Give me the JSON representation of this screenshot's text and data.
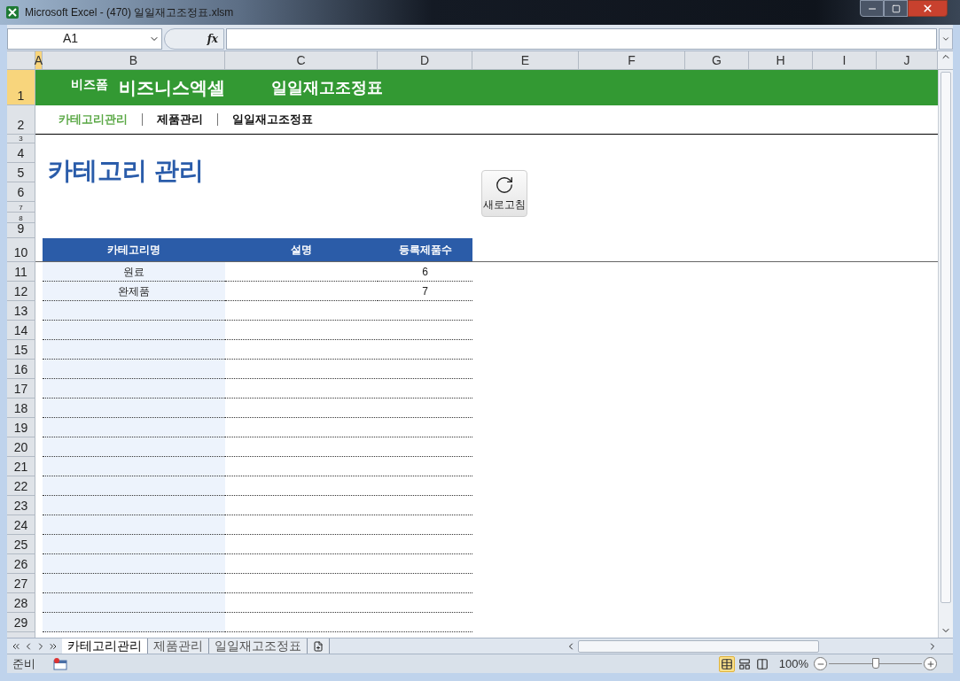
{
  "window": {
    "title": "Microsoft Excel - (470) 일일재고조정표.xlsm"
  },
  "formula_bar": {
    "name_box": "A1",
    "function_label": "fx"
  },
  "columns": [
    {
      "label": "A",
      "selected": true
    },
    {
      "label": "B",
      "selected": false
    },
    {
      "label": "C",
      "selected": false
    },
    {
      "label": "D",
      "selected": false
    },
    {
      "label": "E",
      "selected": false
    },
    {
      "label": "F",
      "selected": false
    },
    {
      "label": "G",
      "selected": false
    },
    {
      "label": "H",
      "selected": false
    },
    {
      "label": "I",
      "selected": false
    },
    {
      "label": "J",
      "selected": false
    }
  ],
  "rows": [
    {
      "label": "1",
      "selected": true
    },
    {
      "label": "2",
      "selected": false
    },
    {
      "label": "3",
      "selected": false
    },
    {
      "label": "4",
      "selected": false
    },
    {
      "label": "5",
      "selected": false
    },
    {
      "label": "6",
      "selected": false
    },
    {
      "label": "7",
      "selected": false
    },
    {
      "label": "8",
      "selected": false
    },
    {
      "label": "9",
      "selected": false
    },
    {
      "label": "10",
      "selected": false
    },
    {
      "label": "11",
      "selected": false
    },
    {
      "label": "12",
      "selected": false
    },
    {
      "label": "13",
      "selected": false
    },
    {
      "label": "14",
      "selected": false
    },
    {
      "label": "15",
      "selected": false
    },
    {
      "label": "16",
      "selected": false
    },
    {
      "label": "17",
      "selected": false
    },
    {
      "label": "18",
      "selected": false
    },
    {
      "label": "19",
      "selected": false
    },
    {
      "label": "20",
      "selected": false
    },
    {
      "label": "21",
      "selected": false
    },
    {
      "label": "22",
      "selected": false
    },
    {
      "label": "23",
      "selected": false
    },
    {
      "label": "24",
      "selected": false
    },
    {
      "label": "25",
      "selected": false
    },
    {
      "label": "26",
      "selected": false
    },
    {
      "label": "27",
      "selected": false
    },
    {
      "label": "28",
      "selected": false
    },
    {
      "label": "29",
      "selected": false
    }
  ],
  "banner": {
    "brand_small": "비즈폼",
    "brand": "비즈니스엑셀",
    "title": "일일재고조정표"
  },
  "nav": [
    {
      "label": "카테고리관리",
      "selected": true
    },
    {
      "label": "제품관리",
      "selected": false
    },
    {
      "label": "일일재고조정표",
      "selected": false
    }
  ],
  "heading": "카테고리 관리",
  "refresh_button": "새로고침",
  "table": {
    "columns": [
      "카테고리명",
      "설명",
      "등록제품수"
    ],
    "rows": [
      {
        "name": "원료",
        "count": "6"
      },
      {
        "name": "완제품",
        "count": "7"
      }
    ]
  },
  "sheet_tabs": [
    {
      "label": "카테고리관리",
      "selected": true
    },
    {
      "label": "제품관리",
      "selected": false
    },
    {
      "label": "일일재고조정표",
      "selected": false
    }
  ],
  "status_bar": {
    "mode": "준비",
    "views": [
      {
        "kind": "normal",
        "selected": true
      },
      {
        "kind": "page_layout",
        "selected": false
      },
      {
        "kind": "page_break",
        "selected": false
      }
    ],
    "zoom": "100%",
    "zoom_slider": {
      "level": 0.5
    }
  }
}
